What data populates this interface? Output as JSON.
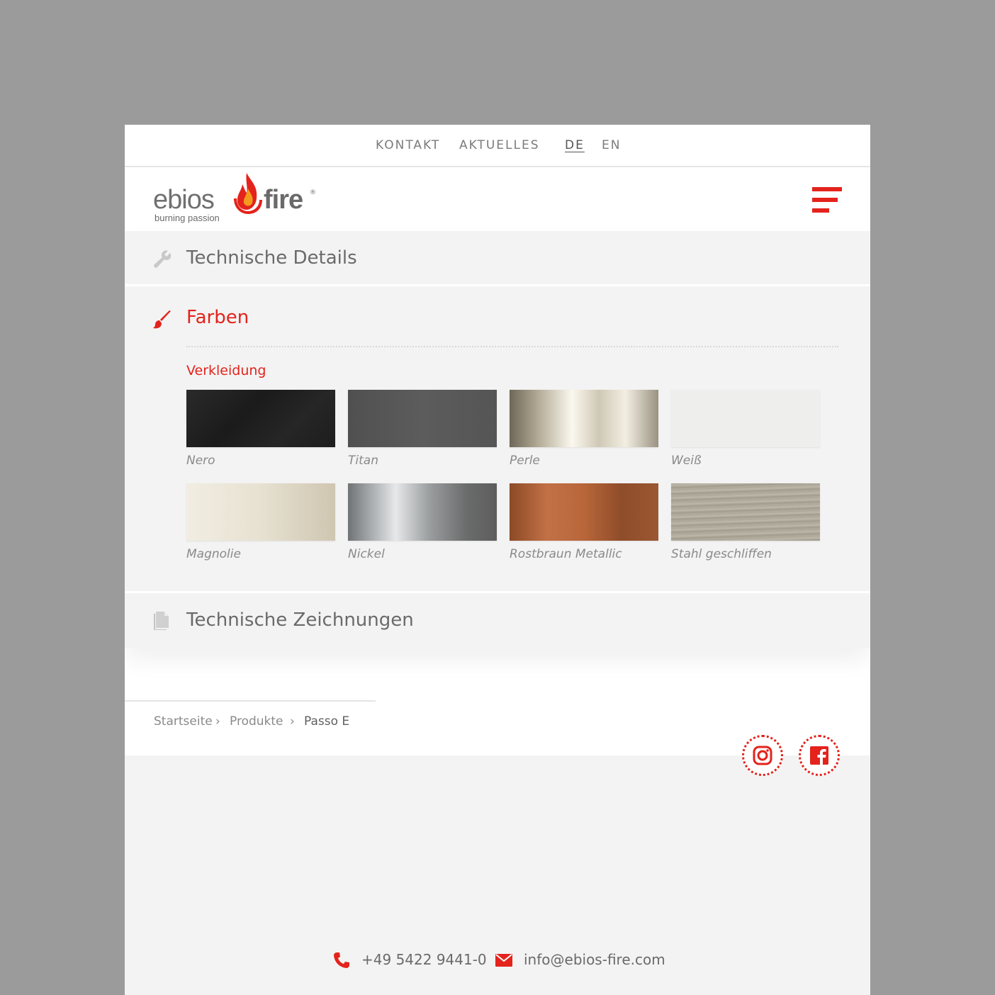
{
  "topnav": {
    "kontakt": "KONTAKT",
    "aktuelles": "AKTUELLES",
    "lang_de": "DE",
    "lang_en": "EN"
  },
  "logo": {
    "word1": "ebios",
    "word2": "fire",
    "registered": "®",
    "tagline": "burning passion"
  },
  "accordion": {
    "technische_details": "Technische Details",
    "farben": "Farben",
    "technische_zeichnungen": "Technische Zeichnungen"
  },
  "farben": {
    "section": "Verkleidung",
    "swatches": [
      {
        "label": "Nero"
      },
      {
        "label": "Titan"
      },
      {
        "label": "Perle"
      },
      {
        "label": "Weiß"
      },
      {
        "label": "Magnolie"
      },
      {
        "label": "Nickel"
      },
      {
        "label": "Rostbraun Metallic"
      },
      {
        "label": "Stahl geschliffen"
      }
    ]
  },
  "breadcrumb": {
    "home": "Startseite",
    "sep1": "›",
    "products": "Produkte",
    "sep2": "›",
    "current": "Passo E"
  },
  "footer": {
    "phone": "+49 5422 9441-0",
    "email": "info@ebios-fire.com"
  },
  "colors": {
    "accent": "#e3231c",
    "text": "#6a6a6a",
    "panel": "#f3f3f3",
    "backdrop": "#9b9b9b"
  },
  "icons": {
    "details": "wrench-icon",
    "farben": "paintbrush-icon",
    "zeichnungen": "document-icon",
    "menu": "hamburger-menu-icon",
    "instagram": "instagram-icon",
    "facebook": "facebook-icon",
    "phone": "phone-icon",
    "email": "envelope-icon"
  }
}
